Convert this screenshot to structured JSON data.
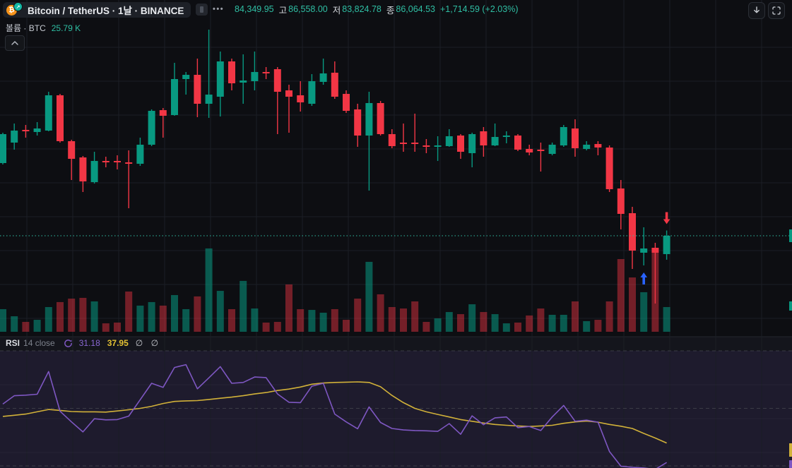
{
  "header": {
    "title": "Bitcoin / TetherUS · 1날 · BINANCE",
    "more_label": "•••",
    "ohlc": {
      "open": "84,349.95",
      "high_label": "고",
      "high": "86,558.00",
      "low_label": "저",
      "low": "83,824.78",
      "close_label": "종",
      "close": "86,064.53",
      "change": "+1,714.59 (+2.03%)"
    }
  },
  "volume_legend": {
    "label": "볼륨 · BTC",
    "value": "25.79 K"
  },
  "rsi_legend": {
    "name": "RSI",
    "params": "14 close",
    "value": "31.18",
    "ma_value": "37.95",
    "empty": "∅ ∅"
  },
  "icons": {
    "logo": "₿",
    "logo_badge": "↗",
    "download": "arrow-down",
    "fullscreen": "corners",
    "collapse": "chevron-up",
    "refresh": "circular-arrows"
  },
  "colors": {
    "up": "#089981",
    "down": "#f23645",
    "vol_up": "rgba(8,153,129,0.55)",
    "vol_down": "rgba(242,54,69,0.45)",
    "accent_teal": "#2fbfa4",
    "rsi_line": "#7e57c2",
    "rsi_ma_line": "#d1b139",
    "marker_up": "#2962ff",
    "marker_down": "#f23645",
    "grid": "#1b1e25",
    "level_dash": "#56575e",
    "rsi_band_fill": "rgba(126,87,194,0.10)",
    "rsi_pane_bg": "#14151c"
  },
  "chart_data": {
    "type": "candlestick",
    "title": "BTCUSDT daily with volume and RSI(14)",
    "price_line": 86064.53,
    "visible_price_range": [
      79500,
      105500
    ],
    "candles_ohlcv": [
      [
        92862,
        95700,
        92730,
        95568,
        23.6
      ],
      [
        94776,
        96558,
        94116,
        95898,
        16.2
      ],
      [
        95964,
        96426,
        95238,
        95832,
        10.3
      ],
      [
        95766,
        96690,
        95436,
        96096,
        12.5
      ],
      [
        95898,
        99528,
        95832,
        99198,
        25.8
      ],
      [
        99198,
        99330,
        94776,
        94908,
        31.0
      ],
      [
        94908,
        95040,
        91278,
        93258,
        34.6
      ],
      [
        93390,
        93522,
        90156,
        91146,
        35.4
      ],
      [
        91080,
        93918,
        90948,
        93060,
        31.7
      ],
      [
        93060,
        93456,
        92466,
        92928,
        8.8
      ],
      [
        93060,
        93588,
        92268,
        92928,
        9.6
      ],
      [
        92928,
        94050,
        88638,
        92796,
        42.0
      ],
      [
        92796,
        95238,
        92598,
        94578,
        27.3
      ],
      [
        94578,
        97878,
        94446,
        97746,
        31.0
      ],
      [
        97812,
        98010,
        95238,
        97284,
        27.3
      ],
      [
        97350,
        102234,
        97284,
        100716,
        38.3
      ],
      [
        100716,
        101376,
        99264,
        101112,
        23.6
      ],
      [
        101112,
        102630,
        97152,
        98406,
        36.9
      ],
      [
        98406,
        105336,
        97086,
        99264,
        87.0
      ],
      [
        99066,
        103290,
        97218,
        102366,
        42.7
      ],
      [
        102366,
        102630,
        99660,
        100320,
        23.6
      ],
      [
        100386,
        103026,
        98406,
        100584,
        53.1
      ],
      [
        100518,
        103290,
        99660,
        101376,
        24.3
      ],
      [
        101376,
        101838,
        100716,
        101244,
        9.6
      ],
      [
        101640,
        101838,
        95568,
        99528,
        10.3
      ],
      [
        99660,
        100188,
        95700,
        99066,
        49.4
      ],
      [
        99198,
        100518,
        97680,
        98538,
        23.6
      ],
      [
        98406,
        101178,
        98208,
        100518,
        22.8
      ],
      [
        100452,
        102630,
        100188,
        101244,
        19.9
      ],
      [
        101310,
        102366,
        98868,
        99066,
        23.6
      ],
      [
        99330,
        99660,
        97548,
        97746,
        12.5
      ],
      [
        97878,
        98406,
        94380,
        95436,
        34.6
      ],
      [
        95436,
        99528,
        90288,
        98472,
        73.0
      ],
      [
        98472,
        98670,
        95436,
        95568,
        39.1
      ],
      [
        95568,
        96030,
        94248,
        94446,
        25.8
      ],
      [
        94776,
        96558,
        93918,
        94644,
        24.3
      ],
      [
        94776,
        97482,
        93918,
        94644,
        31.7
      ],
      [
        94512,
        95106,
        93786,
        94380,
        10.3
      ],
      [
        94380,
        95370,
        93060,
        94512,
        14.0
      ],
      [
        94446,
        96030,
        94380,
        95370,
        20.6
      ],
      [
        95436,
        95568,
        93258,
        93918,
        18.4
      ],
      [
        93786,
        95700,
        92466,
        95568,
        28.7
      ],
      [
        95832,
        96228,
        93456,
        94512,
        20.6
      ],
      [
        94512,
        96558,
        94446,
        95304,
        18.4
      ],
      [
        95304,
        95832,
        94710,
        95436,
        8.8
      ],
      [
        95436,
        95568,
        93984,
        94116,
        9.6
      ],
      [
        94182,
        94578,
        93588,
        93852,
        17.0
      ],
      [
        94116,
        94776,
        92070,
        93984,
        24.3
      ],
      [
        93720,
        94776,
        93588,
        94578,
        17.7
      ],
      [
        94512,
        96426,
        94380,
        96228,
        17.7
      ],
      [
        96096,
        96954,
        93456,
        94248,
        31.7
      ],
      [
        94182,
        94908,
        94050,
        94578,
        11.1
      ],
      [
        94644,
        94908,
        93588,
        94314,
        12.5
      ],
      [
        94314,
        94512,
        90156,
        90420,
        31.7
      ],
      [
        90486,
        91278,
        86658,
        88110,
        75.9
      ],
      [
        88176,
        88770,
        82962,
        84678,
        56.7
      ],
      [
        84480,
        86856,
        83292,
        84876,
        41.3
      ],
      [
        84942,
        85404,
        79728,
        84480,
        83.3
      ],
      [
        84349.95,
        86558.0,
        83824.78,
        86064.53,
        25.79
      ]
    ],
    "volume_unit": "K",
    "markers": [
      {
        "index": 56,
        "type": "arrow-up",
        "color": "#2962ff"
      },
      {
        "index": 58,
        "type": "arrow-down",
        "color": "#f23645"
      }
    ],
    "rsi": {
      "length": 14,
      "source": "close",
      "levels": [
        70,
        50,
        30
      ],
      "values": [
        51.5,
        54.4,
        54.6,
        54.9,
        62.8,
        49.0,
        45.3,
        41.8,
        46.4,
        46.0,
        46.1,
        47.3,
        53.0,
        58.7,
        57.3,
        64.2,
        65.2,
        56.8,
        60.6,
        64.5,
        58.7,
        59.0,
        60.9,
        60.7,
        55.0,
        52.1,
        52.0,
        57.7,
        58.7,
        48.0,
        45.3,
        42.9,
        50.5,
        45.1,
        43.0,
        42.5,
        42.3,
        42.2,
        42.0,
        44.7,
        41.0,
        47.4,
        44.3,
        46.7,
        47.0,
        43.3,
        43.7,
        42.3,
        47.0,
        51.0,
        45.5,
        45.9,
        45.2,
        35.0,
        29.9,
        29.5,
        29.3,
        28.8,
        31.18
      ],
      "ma_values": [
        47.2,
        47.6,
        48.0,
        48.8,
        49.6,
        49.3,
        48.9,
        48.8,
        48.8,
        48.7,
        49.1,
        49.5,
        50.0,
        50.7,
        51.7,
        52.4,
        52.6,
        52.7,
        53.1,
        53.5,
        53.9,
        54.4,
        55.0,
        55.5,
        56.2,
        56.7,
        57.4,
        58.4,
        58.8,
        59.0,
        59.1,
        59.2,
        59.0,
        57.5,
        54.5,
        52.0,
        50.0,
        48.8,
        47.9,
        47.0,
        46.1,
        45.5,
        44.9,
        44.4,
        44.1,
        43.9,
        43.7,
        43.9,
        44.1,
        44.8,
        45.3,
        45.6,
        45.2,
        44.4,
        43.8,
        43.0,
        41.3,
        39.7,
        37.95
      ]
    }
  }
}
